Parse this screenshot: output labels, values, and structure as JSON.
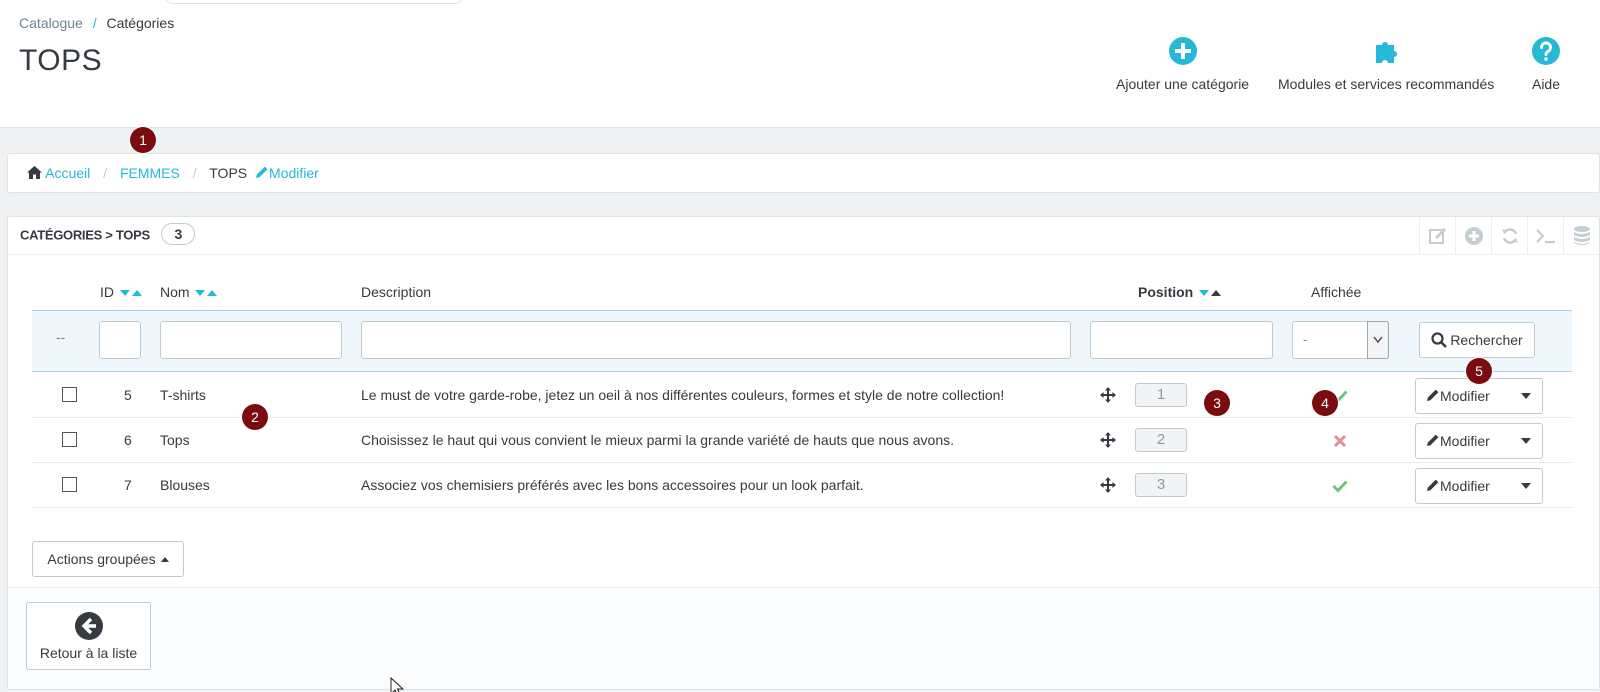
{
  "breadcrumb_top": {
    "parent": "Catalogue",
    "separator": "/",
    "current": "Catégories"
  },
  "page_title": "TOPS",
  "toolbar": {
    "add_category": "Ajouter une catégorie",
    "modules": "Modules et services recommandés",
    "help": "Aide"
  },
  "breadcrumb": {
    "home": "Accueil",
    "separator": "/",
    "parent": "FEMMES",
    "current": "TOPS",
    "edit": "Modifier"
  },
  "panel": {
    "title": "CATÉGORIES > TOPS",
    "count": "3"
  },
  "table": {
    "headers": {
      "id": "ID",
      "name": "Nom",
      "description": "Description",
      "position": "Position",
      "displayed": "Affichée"
    },
    "filter": {
      "bulk_placeholder": "--",
      "displayed_value": "-",
      "search_label": "Rechercher"
    },
    "rows": [
      {
        "id": "5",
        "name": "T-shirts",
        "description": "Le must de votre garde-robe, jetez un oeil à nos différentes couleurs, formes et style de notre collection!",
        "position": "1",
        "displayed": true,
        "action": "Modifier"
      },
      {
        "id": "6",
        "name": "Tops",
        "description": "Choisissez le haut qui vous convient le mieux parmi la grande variété de hauts que nous avons.",
        "position": "2",
        "displayed": false,
        "action": "Modifier"
      },
      {
        "id": "7",
        "name": "Blouses",
        "description": "Associez vos chemisiers préférés avec les bons accessoires pour un look parfait.",
        "position": "3",
        "displayed": true,
        "action": "Modifier"
      }
    ]
  },
  "bulk_actions": "Actions groupées",
  "back_to_list": "Retour à la liste",
  "markers": [
    "1",
    "2",
    "3",
    "4",
    "5"
  ],
  "colors": {
    "accent": "#25b9d7",
    "marker": "#7a0c10",
    "check": "#72c279",
    "cross": "#e08f95"
  }
}
